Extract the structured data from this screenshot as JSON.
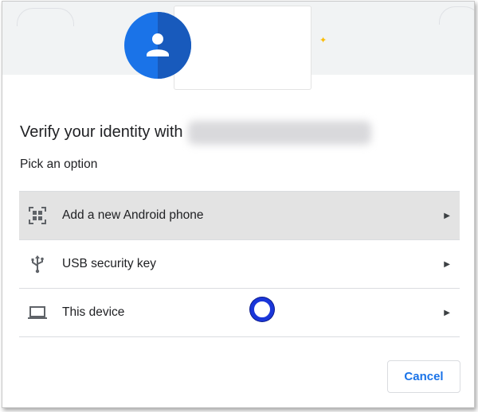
{
  "dialog": {
    "title": "Verify your identity with",
    "subtitle": "Pick an option"
  },
  "options": [
    {
      "label": "Add a new Android phone",
      "icon": "qr-code-icon"
    },
    {
      "label": "USB security key",
      "icon": "usb-icon"
    },
    {
      "label": "This device",
      "icon": "laptop-icon"
    }
  ],
  "buttons": {
    "cancel_label": "Cancel"
  },
  "colors": {
    "accent": "#1a73e8",
    "avatar": "#1a73e8",
    "selected_row": "#e3e3e3",
    "sparkle": "#fbbc04"
  }
}
